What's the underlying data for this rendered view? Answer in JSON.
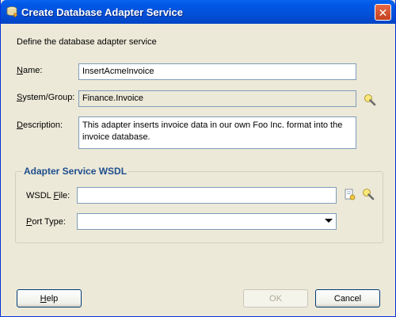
{
  "window": {
    "title": "Create Database Adapter Service",
    "close_glyph": "✕"
  },
  "intro_text": "Define the database adapter service",
  "fields": {
    "name": {
      "label_first": "N",
      "label_rest": "ame:",
      "value": "InsertAcmeInvoice"
    },
    "system_group": {
      "label_first": "S",
      "label_rest": "ystem/Group:",
      "value": "Finance.Invoice"
    },
    "description": {
      "label_first": "D",
      "label_rest": "escription:",
      "value": "This adapter inserts invoice data in our own Foo Inc. format into the invoice database."
    }
  },
  "wsdl_group": {
    "title": "Adapter Service WSDL",
    "wsdl_file": {
      "label_pre": "WSDL ",
      "label_u": "F",
      "label_post": "ile:",
      "value": ""
    },
    "port_type": {
      "label_pre": "",
      "label_u": "P",
      "label_post": "ort Type:",
      "value": ""
    }
  },
  "buttons": {
    "help": {
      "u": "H",
      "rest": "elp"
    },
    "ok": "OK",
    "cancel": "Cancel"
  },
  "icons": {
    "title": "database-adapter-icon",
    "browse": "flashlight-icon",
    "wsdl_file_browse": "document-browse-icon"
  },
  "colors": {
    "titlebar": "#0350d8",
    "group_title": "#1f4e8c",
    "field_border": "#7f9db9"
  }
}
